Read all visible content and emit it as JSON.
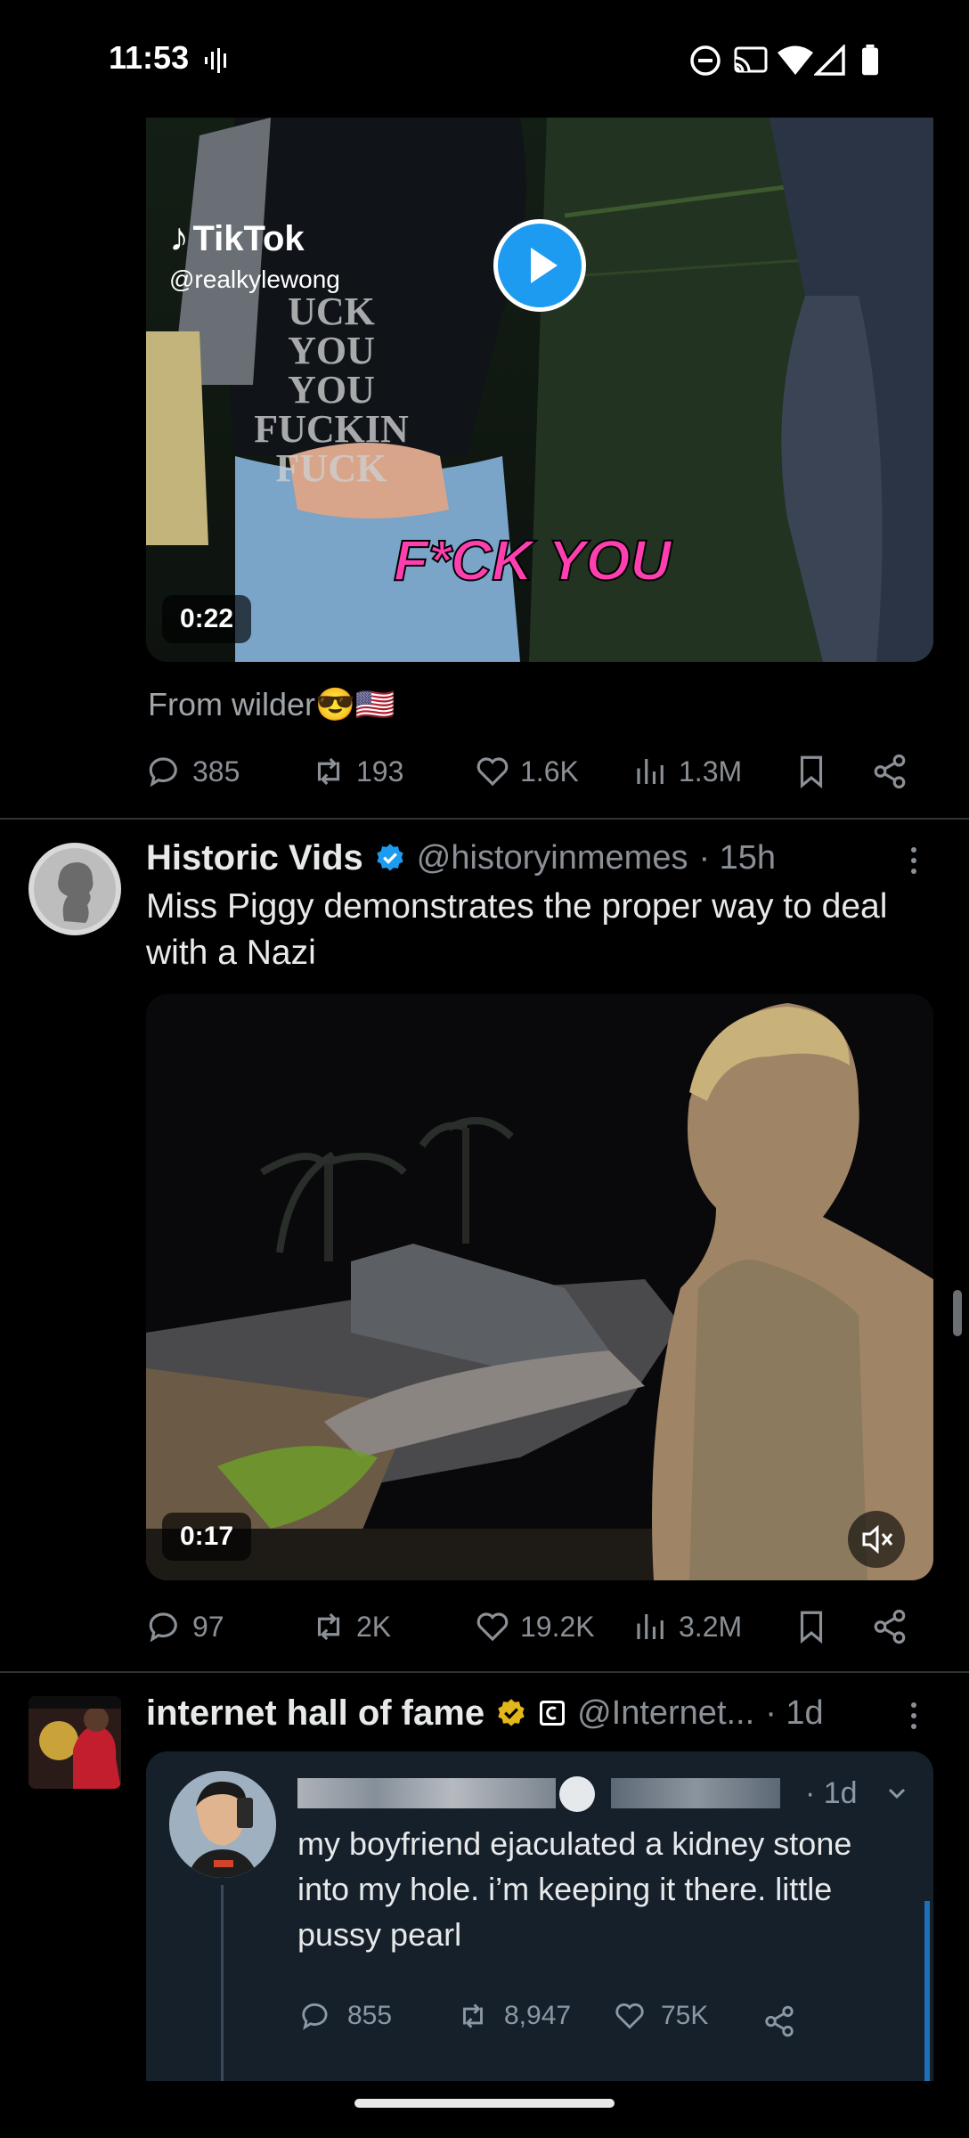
{
  "status_bar": {
    "time": "11:53"
  },
  "tweet1": {
    "media": {
      "watermark_brand": "TikTok",
      "watermark_handle": "@realkylewong",
      "overlay_text": "F*CK YOU",
      "shirt_text": "UCK YOU YOU FUCKIN FUCK",
      "duration": "0:22"
    },
    "caption": "From wilder😎🇺🇸",
    "stats": {
      "replies": "385",
      "reposts": "193",
      "likes": "1.6K",
      "views": "1.3M"
    }
  },
  "tweet2": {
    "name": "Historic Vids",
    "handle": "@historyinmemes",
    "time": "· 15h",
    "text": "Miss Piggy demonstrates the proper way to deal with a Nazi",
    "media": {
      "duration": "0:17"
    },
    "stats": {
      "replies": "97",
      "reposts": "2K",
      "likes": "19.2K",
      "views": "3.2M"
    }
  },
  "tweet3": {
    "name": "internet hall of fame",
    "handle": "@Internet...",
    "time": "· 1d",
    "quoted": {
      "time": "· 1d",
      "text": "my boyfriend ejaculated a kidney stone into my hole. i’m keeping it there. little pussy pearl",
      "stats": {
        "replies": "855",
        "reposts": "8,947",
        "likes": "75K"
      }
    }
  },
  "colors": {
    "background": "#000000",
    "verified_blue": "#1d9bf0",
    "verified_gold": "#e2b719",
    "muted": "#8b9096",
    "text": "#e7e9ea"
  }
}
